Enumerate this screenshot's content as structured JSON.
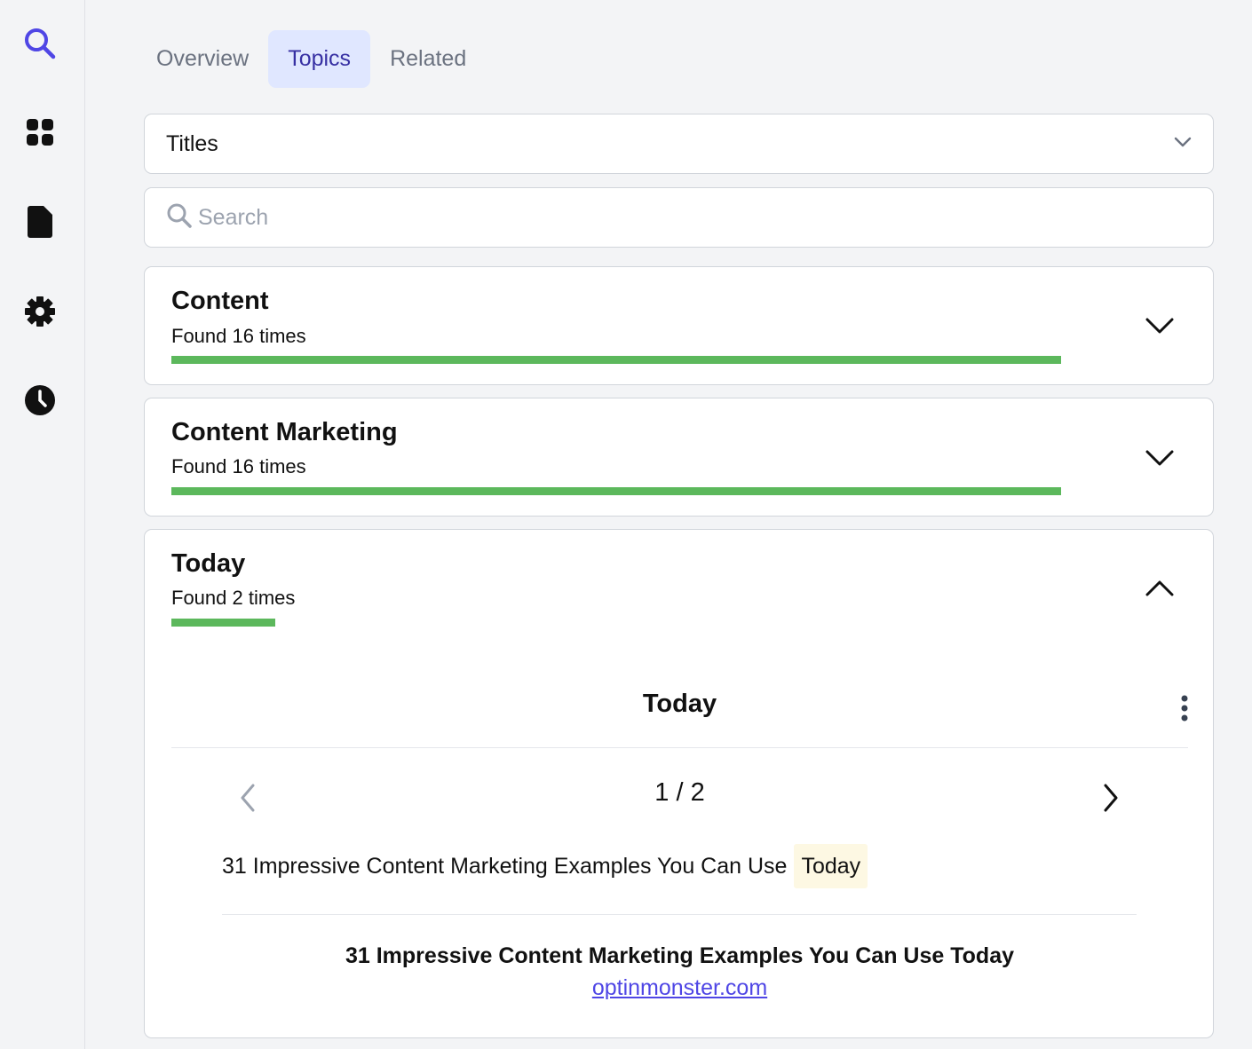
{
  "sidebar": {
    "icons": [
      "search-icon",
      "grid-icon",
      "document-icon",
      "gear-icon",
      "clock-icon"
    ],
    "accent": "#4f46e5"
  },
  "tabs": [
    {
      "label": "Overview",
      "active": false
    },
    {
      "label": "Topics",
      "active": true
    },
    {
      "label": "Related",
      "active": false
    }
  ],
  "filter": {
    "selected": "Titles"
  },
  "search": {
    "placeholder": "Search",
    "value": ""
  },
  "topics": [
    {
      "title": "Content",
      "count_text": "Found 16 times",
      "count": 16,
      "expanded": false
    },
    {
      "title": "Content Marketing",
      "count_text": "Found 16 times",
      "count": 16,
      "expanded": false
    },
    {
      "title": "Today",
      "count_text": "Found 2 times",
      "count": 2,
      "expanded": true
    }
  ],
  "detail": {
    "title": "Today",
    "pager": "1 / 2",
    "snippet_before": "31 Impressive Content Marketing Examples You Can Use",
    "snippet_highlight": "Today",
    "result_title": "31 Impressive Content Marketing Examples You Can Use Today",
    "result_domain": "optinmonster.com"
  },
  "colors": {
    "bar": "#5cb85c",
    "tab_active_bg": "#e0e7ff",
    "tab_active_text": "#3730a3",
    "highlight_bg": "#fdf8e3"
  }
}
